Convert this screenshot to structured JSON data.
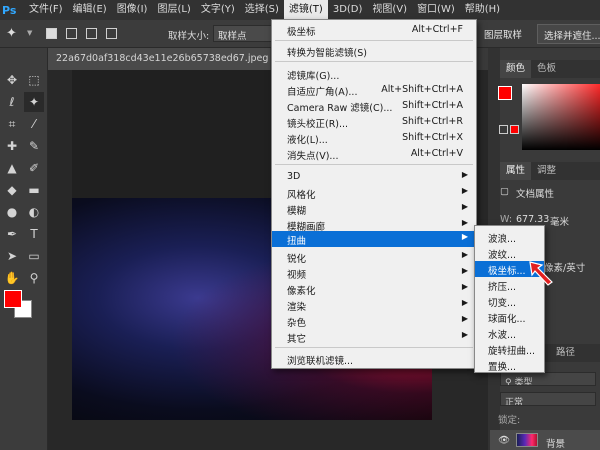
{
  "menubar": {
    "logo": "Ps",
    "items": [
      "文件(F)",
      "编辑(E)",
      "图像(I)",
      "图层(L)",
      "文字(Y)",
      "选择(S)",
      "滤镜(T)",
      "3D(D)",
      "视图(V)",
      "窗口(W)",
      "帮助(H)"
    ],
    "active": "滤镜(T)"
  },
  "options": {
    "sample_label": "取样大小:",
    "sample_value": "取样点",
    "right_button_1": "图层取样",
    "right_button_2": "选择并遮住..."
  },
  "document": {
    "tab_title": "22a67d0af318cd43e11e26b65738ed67.jpeg @ 25%(..."
  },
  "filter_menu": {
    "items": [
      {
        "label": "极坐标",
        "shortcut": "Alt+Ctrl+F"
      },
      {
        "label": "转换为智能滤镜(S)",
        "shortcut": ""
      },
      {
        "label": "滤镜库(G)...",
        "shortcut": ""
      },
      {
        "label": "自适应广角(A)...",
        "shortcut": "Alt+Shift+Ctrl+A"
      },
      {
        "label": "Camera Raw 滤镜(C)...",
        "shortcut": "Shift+Ctrl+A"
      },
      {
        "label": "镜头校正(R)...",
        "shortcut": "Shift+Ctrl+R"
      },
      {
        "label": "液化(L)...",
        "shortcut": "Shift+Ctrl+X"
      },
      {
        "label": "消失点(V)...",
        "shortcut": "Alt+Ctrl+V"
      },
      {
        "label": "3D",
        "shortcut": ""
      },
      {
        "label": "风格化",
        "shortcut": ""
      },
      {
        "label": "模糊",
        "shortcut": ""
      },
      {
        "label": "模糊画廊",
        "shortcut": ""
      },
      {
        "label": "扭曲",
        "shortcut": ""
      },
      {
        "label": "锐化",
        "shortcut": ""
      },
      {
        "label": "视频",
        "shortcut": ""
      },
      {
        "label": "像素化",
        "shortcut": ""
      },
      {
        "label": "渲染",
        "shortcut": ""
      },
      {
        "label": "杂色",
        "shortcut": ""
      },
      {
        "label": "其它",
        "shortcut": ""
      },
      {
        "label": "浏览联机滤镜...",
        "shortcut": ""
      }
    ],
    "highlighted": "扭曲"
  },
  "distort_submenu": {
    "items": [
      "波浪...",
      "波纹...",
      "极坐标...",
      "挤压...",
      "切变...",
      "球面化...",
      "水波...",
      "旋转扭曲...",
      "置换..."
    ],
    "highlighted": "极坐标..."
  },
  "panels": {
    "color_tab": "颜色",
    "swatches_tab": "色板",
    "properties_tab": "属性",
    "adjust_tab": "调整",
    "doc_props": "文档属性",
    "width_label": "W:",
    "width_value": "677.33",
    "width_unit": "毫米",
    "resolution_text": "像素/英寸",
    "paths_tab": "路径",
    "type_filter": "类型",
    "blend_mode": "正常",
    "lock_label": "锁定:",
    "layer_name": "背景"
  },
  "colors": {
    "foreground": "#ff0000",
    "background": "#ffffff",
    "menu_highlight": "#0a6fd6",
    "pointer": "#e02020"
  }
}
